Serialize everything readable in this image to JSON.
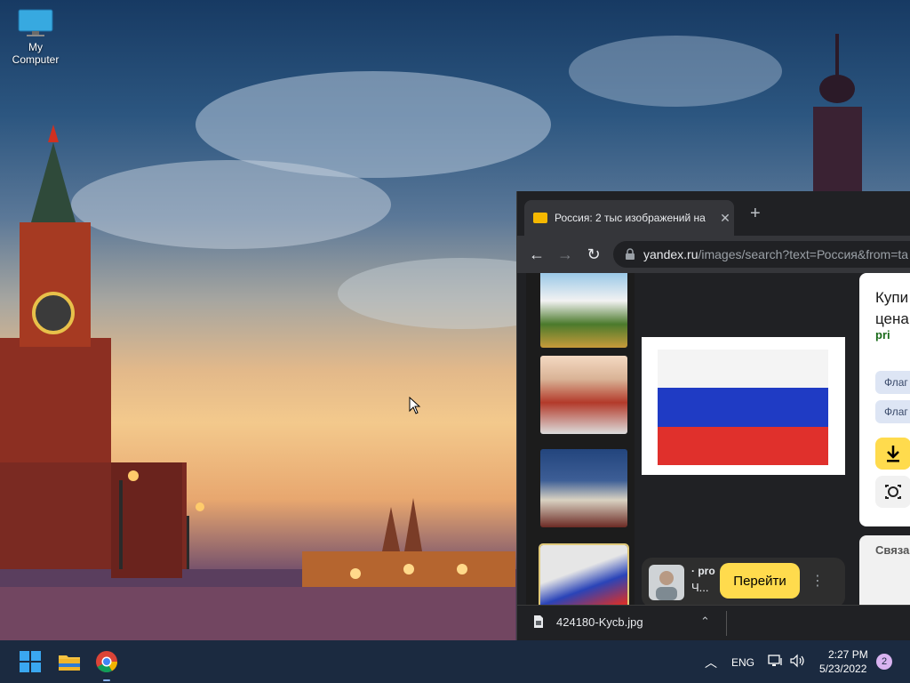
{
  "desktop": {
    "icon_label": "My Computer"
  },
  "browser": {
    "tab_title": "Россия: 2 тыс изображений на",
    "new_tab": "+",
    "url_host": "yandex.ru",
    "url_path": "/images/search?text=Россия&from=ta",
    "side_title": "Купи цена",
    "side_source": "pri",
    "side_chips": [
      "Флаг",
      "Флаг"
    ],
    "related_label": "Связа",
    "source_name": "· pro",
    "source_desc": "Ч...",
    "go_button": "Перейти",
    "download_file": "424180-Kycb.jpg"
  },
  "taskbar": {
    "language": "ENG",
    "time": "2:27 PM",
    "date": "5/23/2022",
    "notifications": "2"
  },
  "colors": {
    "flag_white": "#f4f4f4",
    "flag_blue": "#1f3bc4",
    "flag_red": "#e0302c",
    "yandex_yellow": "#ffdb4d"
  }
}
